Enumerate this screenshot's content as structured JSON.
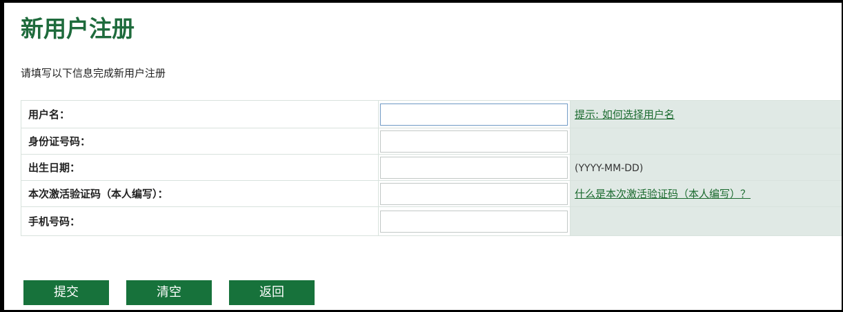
{
  "page": {
    "title": "新用户注册",
    "description": "请填写以下信息完成新用户注册"
  },
  "form": {
    "fields": [
      {
        "label": "用户名：",
        "value": "",
        "hint": "提示: 如何选择用户名",
        "hint_type": "link"
      },
      {
        "label": "身份证号码：",
        "value": "",
        "hint": "",
        "hint_type": "none"
      },
      {
        "label": "出生日期：",
        "value": "",
        "hint": "(YYYY-MM-DD)",
        "hint_type": "text"
      },
      {
        "label": "本次激活验证码（本人编写）：",
        "value": "",
        "hint": "什么是本次激活验证码（本人编写）？",
        "hint_type": "link"
      },
      {
        "label": "手机号码：",
        "value": "",
        "hint": "",
        "hint_type": "none"
      }
    ]
  },
  "buttons": {
    "submit": "提交",
    "clear": "清空",
    "back": "返回"
  },
  "colors": {
    "title": "#1e6b3c",
    "button_bg": "#17723b",
    "hint_bg": "#e0e9e5",
    "link": "#1a6a2e"
  }
}
